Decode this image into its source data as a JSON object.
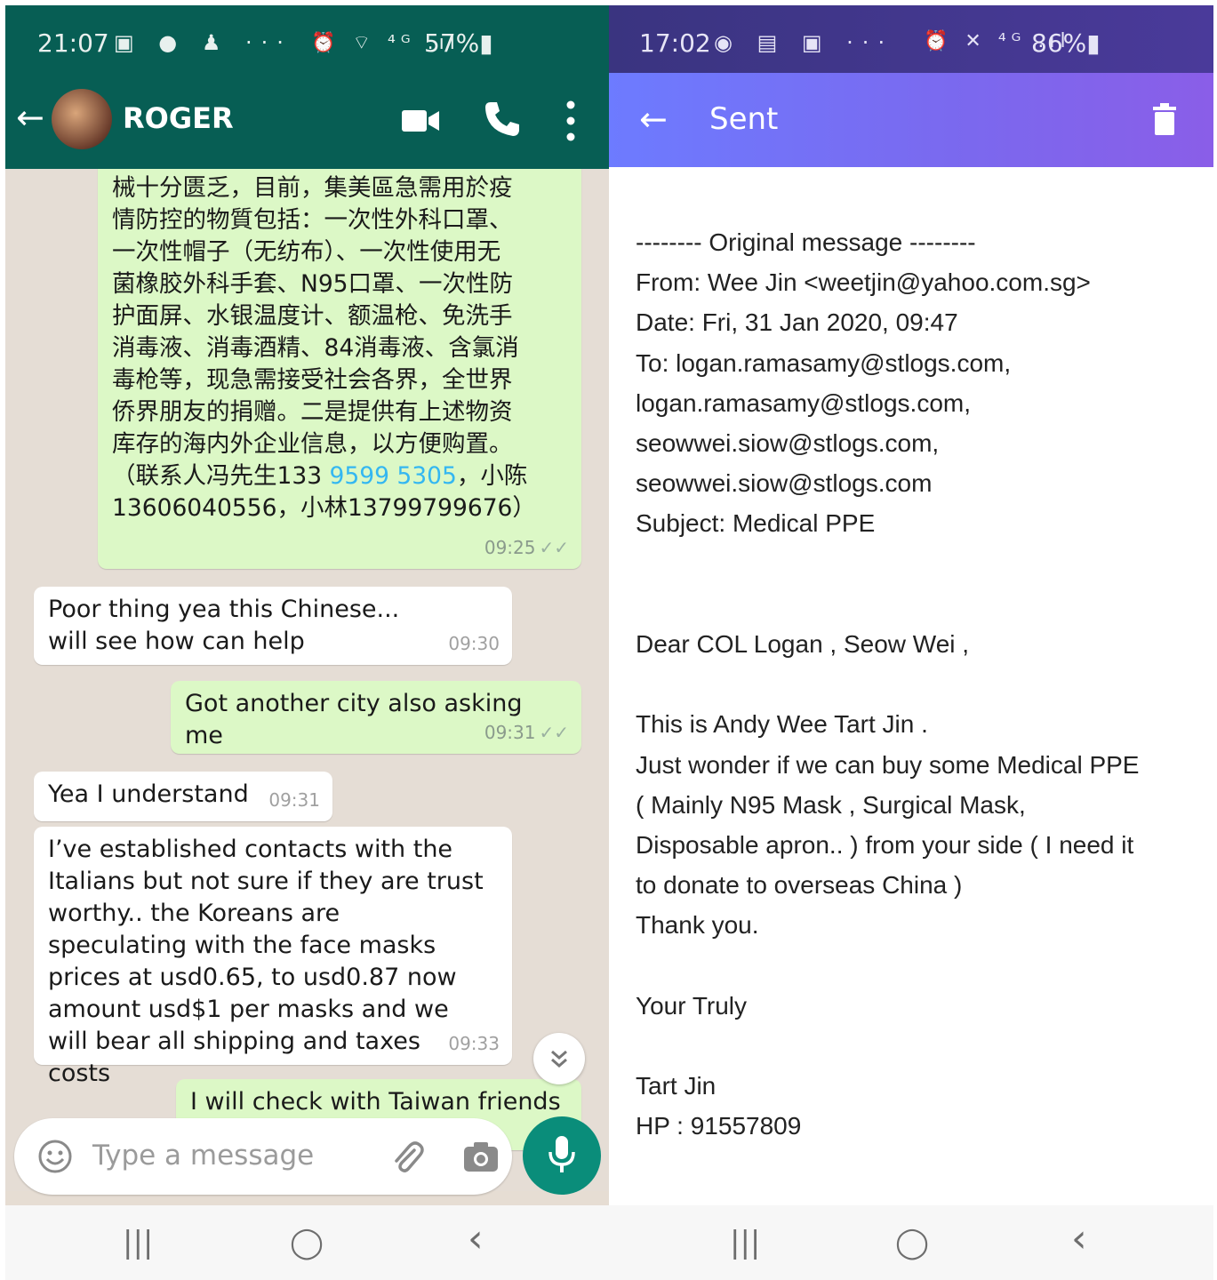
{
  "whatsapp": {
    "status": {
      "time": "21:07",
      "left_icons": "▣ ● ♟ ···",
      "right_icons": "⏰ ⌔ ⁴ᴳ .ıl",
      "battery": "57%▮"
    },
    "header": {
      "contact_name": "ROGER"
    },
    "messages": [
      {
        "dir": "out",
        "lines": [
          "械十分匮乏，目前，集美區急需用於疫",
          "情防控的物質包括：一次性外科口罩、",
          "一次性帽子（无纺布）、一次性使用无",
          "菌橡胶外科手套、N95口罩、一次性防",
          "护面屏、水银温度计、额温枪、免洗手",
          "消毒液、消毒酒精、84消毒液、含氯消",
          "毒枪等，现急需接受社会各界，全世界",
          "侨界朋友的捐赠。二是提供有上述物资",
          "库存的海内外企业信息，以方便购置。"
        ],
        "contact_prefix": "（联系人冯先生133 ",
        "contact_link": "9599 5305",
        "contact_suffix": "，小陈",
        "last_line": "13606040556，小林13799799676）",
        "time": "09:25",
        "ticks": "✓✓"
      },
      {
        "dir": "in",
        "text": "Poor thing yea this Chinese... will see how can help",
        "time": "09:30"
      },
      {
        "dir": "out",
        "text": "Got another city also asking me",
        "time": "09:31",
        "ticks": "✓✓"
      },
      {
        "dir": "in",
        "text": "Yea I understand",
        "time": "09:31"
      },
      {
        "dir": "in",
        "text": "I’ve established contacts with the Italians but not sure if they are trust worthy.. the Koreans are speculating with the face masks prices at usd0.65, to usd0.87 now amount usd$1 per masks and we will bear all shipping and taxes costs",
        "time": "09:33"
      },
      {
        "dir": "out",
        "text": "I will check with Taiwan friends",
        "time": ""
      }
    ],
    "composer": {
      "placeholder": "Type a message"
    },
    "nav": {
      "recents": "|||",
      "home": "◯",
      "back": "‹"
    }
  },
  "email": {
    "status": {
      "time": "17:02",
      "left_icons": "◉ ▤ ▣ ···",
      "right_icons": "⏰ ✕ ⁴ᴳ .ıl",
      "battery": "86%▮"
    },
    "header": {
      "title": "Sent"
    },
    "body_lines": [
      "-------- Original message --------",
      "From: Wee Jin <weetjin@yahoo.com.sg>",
      "Date: Fri, 31 Jan 2020, 09:47",
      "To: logan.ramasamy@stlogs.com,",
      "logan.ramasamy@stlogs.com,",
      "seowwei.siow@stlogs.com,",
      "seowwei.siow@stlogs.com",
      "Subject: Medical PPE",
      "",
      "",
      "Dear COL Logan , Seow Wei ,",
      "",
      "This is Andy Wee Tart Jin .",
      "Just wonder if we can buy some Medical PPE",
      "( Mainly N95 Mask , Surgical Mask,",
      "Disposable apron.. )  from your side ( I need it",
      "to donate to overseas China )",
      "Thank you.",
      "",
      "Your Truly",
      "",
      "Tart Jin",
      "HP : 91557809"
    ],
    "nav": {
      "recents": "|||",
      "home": "◯",
      "back": "‹"
    }
  }
}
